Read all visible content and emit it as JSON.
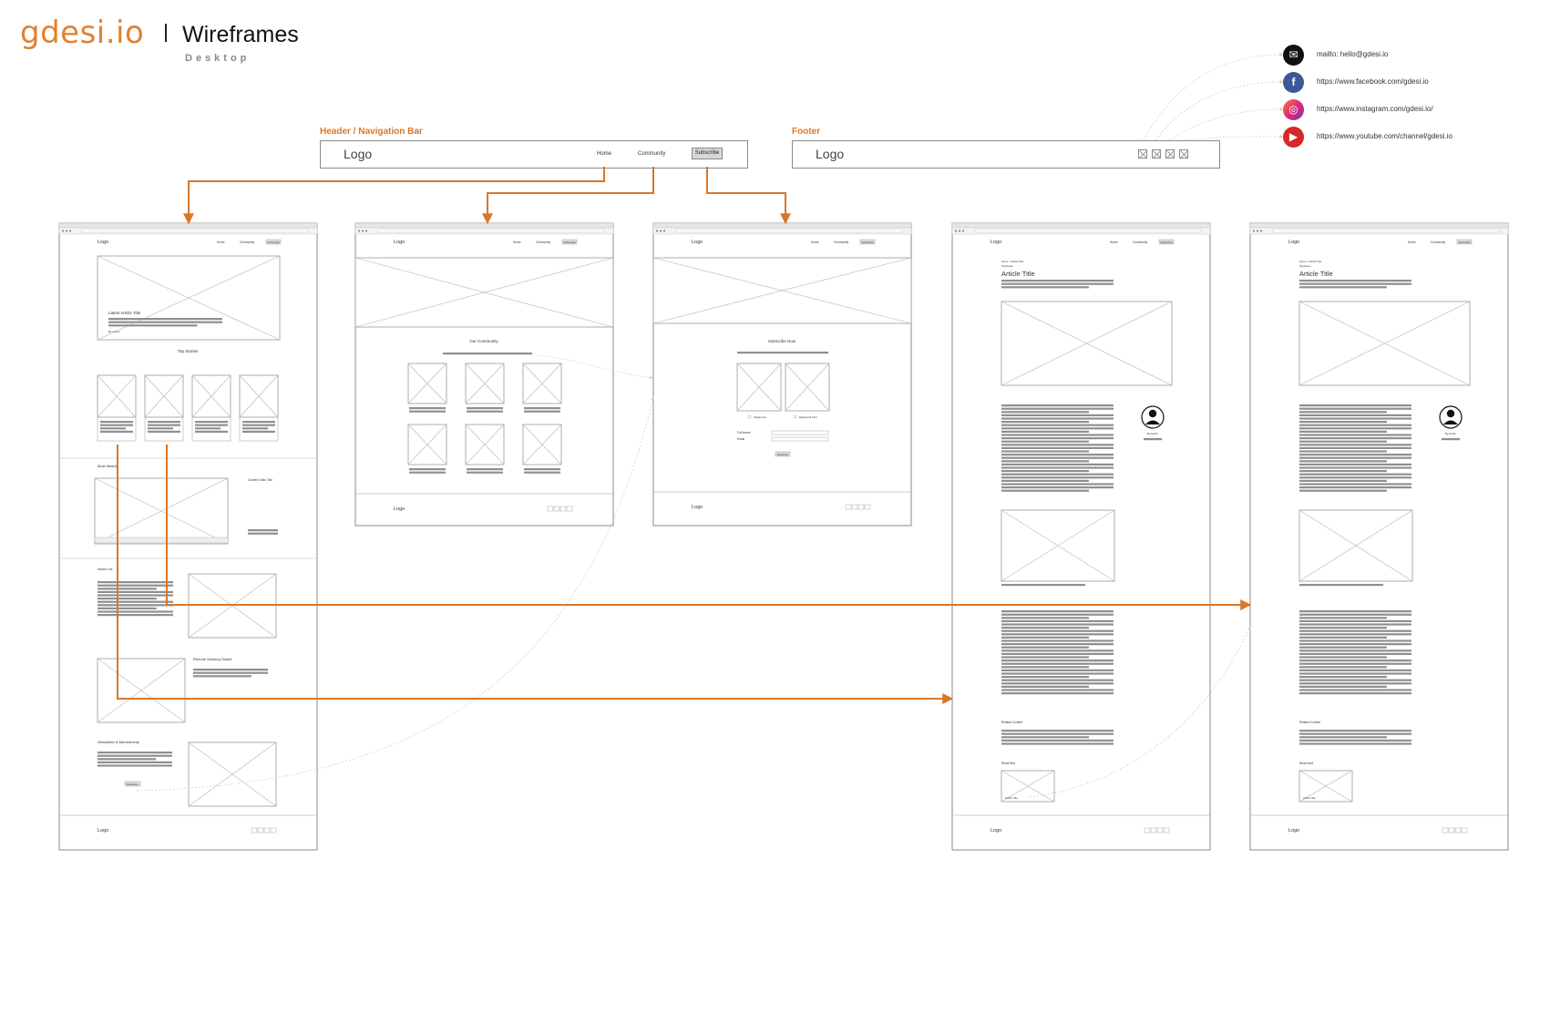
{
  "brand": {
    "name": "gdesi.io",
    "title": "Wireframes",
    "subtitle": "Desktop"
  },
  "sections": {
    "header_label": "Header / Navigation Bar",
    "footer_label": "Footer"
  },
  "header_bar": {
    "logo": "Logo",
    "nav": [
      "Home",
      "Community"
    ],
    "cta": "Subscribe"
  },
  "footer_bar": {
    "logo": "Logo"
  },
  "social_links": [
    {
      "icon": "mail-icon",
      "text": "mailto: hello@gdesi.io"
    },
    {
      "icon": "facebook-icon",
      "text": "https://www.facebook.com/gdesi.io"
    },
    {
      "icon": "instagram-icon",
      "text": "https://www.instagram.com/gdesi.io/"
    },
    {
      "icon": "youtube-icon",
      "text": "https://www.youtube.com/channel/gdesi.io"
    }
  ],
  "colors": {
    "accent": "#e0822f",
    "connector": "#d9772a",
    "wire": "#8a8a8a",
    "text_block": "#8f8f8f"
  },
  "wireframes": {
    "home": {
      "logo": "Logo",
      "nav": [
        "Home",
        "Community",
        "Subscribe"
      ],
      "hero_title": "Latest Article Title",
      "hero_meta": "By Lorem",
      "top_stories": "Top Stories",
      "must_watch": "Must Watch",
      "video_title": "Content Video Title",
      "about": "About Us",
      "toolkit": "Remote Working Toolkit",
      "newsletter": "Newsletter & Membership",
      "newsletter_btn": "Subscribe",
      "footer_logo": "Logo"
    },
    "community": {
      "logo": "Logo",
      "nav": [
        "Home",
        "Community",
        "Subscribe"
      ],
      "heading": "Our Community",
      "footer_logo": "Logo"
    },
    "subscribe": {
      "logo": "Logo",
      "nav": [
        "Home",
        "Community",
        "Subscribe"
      ],
      "heading": "Subscribe Now",
      "option1": "Digital only",
      "option2": "Digital and Print",
      "field1": "Full Name",
      "field2": "Email",
      "submit": "Subscribe",
      "footer_logo": "Logo"
    },
    "article1": {
      "logo": "Logo",
      "nav": [
        "Home",
        "Community",
        "Subscribe"
      ],
      "breadcrumb": "Home > Article Title",
      "tag": "Tag Name",
      "title": "Article Title",
      "author": "By Author",
      "related": "Related Content",
      "read_next": "Read Next",
      "next_title": "Article Title",
      "footer_logo": "Logo"
    },
    "article2": {
      "logo": "Logo",
      "nav": [
        "Home",
        "Community",
        "Subscribe"
      ],
      "breadcrumb": "Home > Article Title",
      "tag": "Tag Name",
      "title": "Article Title",
      "author": "By Author",
      "related": "Related Content",
      "read_next": "Read Next",
      "next_title": "Article Title",
      "footer_logo": "Logo"
    }
  }
}
